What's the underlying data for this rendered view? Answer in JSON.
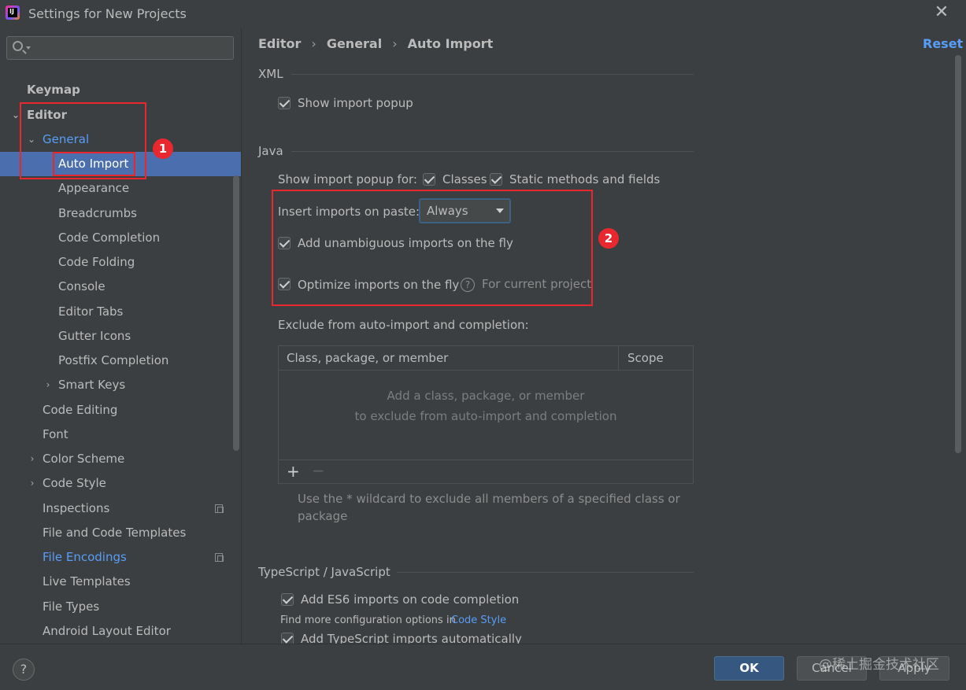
{
  "window": {
    "title": "Settings for New Projects"
  },
  "search": {
    "placeholder": ""
  },
  "sidebar": {
    "items": [
      {
        "label": "Keymap"
      },
      {
        "label": "Editor"
      },
      {
        "label": "General"
      },
      {
        "label": "Auto Import"
      },
      {
        "label": "Appearance"
      },
      {
        "label": "Breadcrumbs"
      },
      {
        "label": "Code Completion"
      },
      {
        "label": "Code Folding"
      },
      {
        "label": "Console"
      },
      {
        "label": "Editor Tabs"
      },
      {
        "label": "Gutter Icons"
      },
      {
        "label": "Postfix Completion"
      },
      {
        "label": "Smart Keys"
      },
      {
        "label": "Code Editing"
      },
      {
        "label": "Font"
      },
      {
        "label": "Color Scheme"
      },
      {
        "label": "Code Style"
      },
      {
        "label": "Inspections"
      },
      {
        "label": "File and Code Templates"
      },
      {
        "label": "File Encodings"
      },
      {
        "label": "Live Templates"
      },
      {
        "label": "File Types"
      },
      {
        "label": "Android Layout Editor"
      }
    ]
  },
  "annotations": {
    "badge1": "1",
    "badge2": "2"
  },
  "breadcrumb": {
    "part1": "Editor",
    "part2": "General",
    "part3": "Auto Import",
    "sep": "›"
  },
  "reset_label": "Reset",
  "xml": {
    "title": "XML",
    "show_import_popup": "Show import popup"
  },
  "java": {
    "title": "Java",
    "show_popup_for": "Show import popup for:",
    "classes": "Classes",
    "static_methods": "Static methods and fields",
    "insert_on_paste": "Insert imports on paste:",
    "insert_value": "Always",
    "add_unambiguous": "Add unambiguous imports on the fly",
    "optimize": "Optimize imports on the fly",
    "for_current_project": "For current project",
    "exclude_label": "Exclude from auto-import and completion:",
    "table": {
      "col1": "Class, package, or member",
      "col2": "Scope",
      "empty_line1": "Add a class, package, or member",
      "empty_line2": "to exclude from auto-import and completion",
      "add": "+",
      "remove": "−"
    },
    "wildcard_hint_1": "Use the * wildcard to exclude all members of a specified class or",
    "wildcard_hint_2": "package"
  },
  "ts": {
    "title": "TypeScript / JavaScript",
    "add_es6": "Add ES6 imports on code completion",
    "find_more": "Find more configuration options in",
    "code_style_link": "Code Style",
    "add_ts_auto": "Add TypeScript imports automatically"
  },
  "footer": {
    "help": "?",
    "ok": "OK",
    "cancel": "Cancel",
    "apply": "Apply",
    "watermark": "@稀土掘金技术社区"
  }
}
